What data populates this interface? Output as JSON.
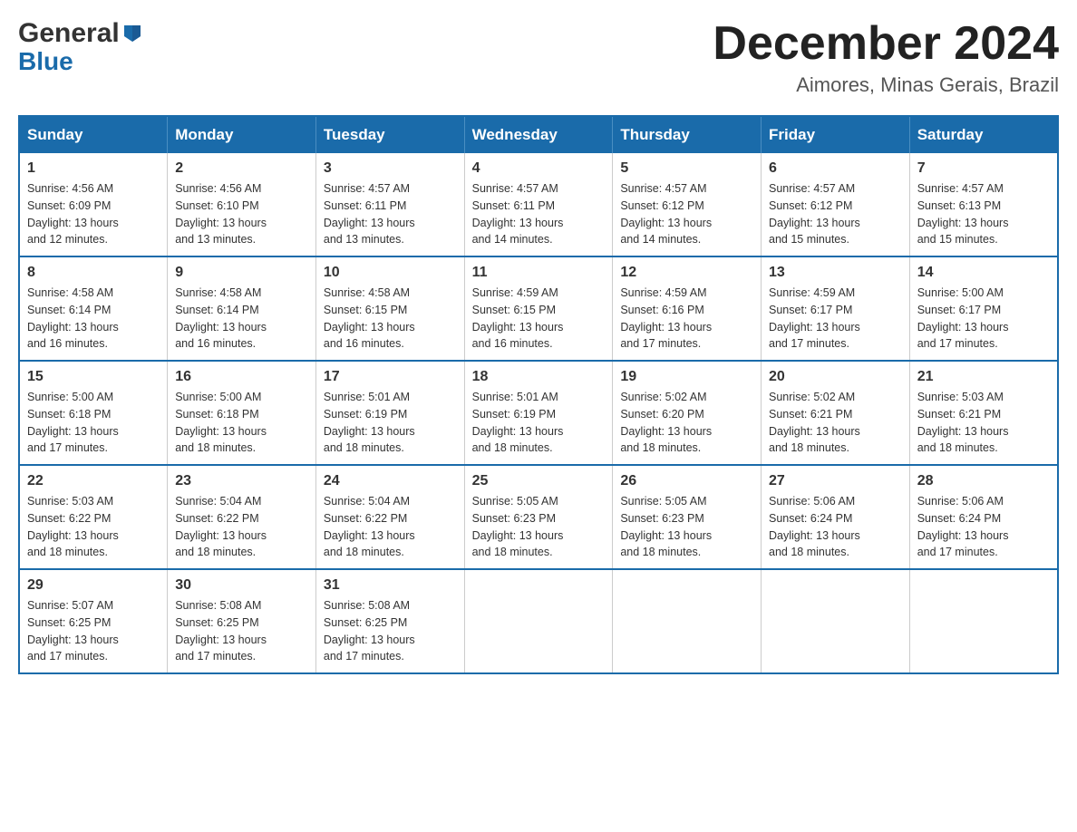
{
  "header": {
    "logo": {
      "general": "General",
      "blue": "Blue",
      "arrow_color": "#1a6baa"
    },
    "title": "December 2024",
    "location": "Aimores, Minas Gerais, Brazil"
  },
  "calendar": {
    "headers": [
      "Sunday",
      "Monday",
      "Tuesday",
      "Wednesday",
      "Thursday",
      "Friday",
      "Saturday"
    ],
    "weeks": [
      [
        {
          "day": "1",
          "sunrise": "4:56 AM",
          "sunset": "6:09 PM",
          "daylight": "13 hours and 12 minutes."
        },
        {
          "day": "2",
          "sunrise": "4:56 AM",
          "sunset": "6:10 PM",
          "daylight": "13 hours and 13 minutes."
        },
        {
          "day": "3",
          "sunrise": "4:57 AM",
          "sunset": "6:11 PM",
          "daylight": "13 hours and 13 minutes."
        },
        {
          "day": "4",
          "sunrise": "4:57 AM",
          "sunset": "6:11 PM",
          "daylight": "13 hours and 14 minutes."
        },
        {
          "day": "5",
          "sunrise": "4:57 AM",
          "sunset": "6:12 PM",
          "daylight": "13 hours and 14 minutes."
        },
        {
          "day": "6",
          "sunrise": "4:57 AM",
          "sunset": "6:12 PM",
          "daylight": "13 hours and 15 minutes."
        },
        {
          "day": "7",
          "sunrise": "4:57 AM",
          "sunset": "6:13 PM",
          "daylight": "13 hours and 15 minutes."
        }
      ],
      [
        {
          "day": "8",
          "sunrise": "4:58 AM",
          "sunset": "6:14 PM",
          "daylight": "13 hours and 16 minutes."
        },
        {
          "day": "9",
          "sunrise": "4:58 AM",
          "sunset": "6:14 PM",
          "daylight": "13 hours and 16 minutes."
        },
        {
          "day": "10",
          "sunrise": "4:58 AM",
          "sunset": "6:15 PM",
          "daylight": "13 hours and 16 minutes."
        },
        {
          "day": "11",
          "sunrise": "4:59 AM",
          "sunset": "6:15 PM",
          "daylight": "13 hours and 16 minutes."
        },
        {
          "day": "12",
          "sunrise": "4:59 AM",
          "sunset": "6:16 PM",
          "daylight": "13 hours and 17 minutes."
        },
        {
          "day": "13",
          "sunrise": "4:59 AM",
          "sunset": "6:17 PM",
          "daylight": "13 hours and 17 minutes."
        },
        {
          "day": "14",
          "sunrise": "5:00 AM",
          "sunset": "6:17 PM",
          "daylight": "13 hours and 17 minutes."
        }
      ],
      [
        {
          "day": "15",
          "sunrise": "5:00 AM",
          "sunset": "6:18 PM",
          "daylight": "13 hours and 17 minutes."
        },
        {
          "day": "16",
          "sunrise": "5:00 AM",
          "sunset": "6:18 PM",
          "daylight": "13 hours and 18 minutes."
        },
        {
          "day": "17",
          "sunrise": "5:01 AM",
          "sunset": "6:19 PM",
          "daylight": "13 hours and 18 minutes."
        },
        {
          "day": "18",
          "sunrise": "5:01 AM",
          "sunset": "6:19 PM",
          "daylight": "13 hours and 18 minutes."
        },
        {
          "day": "19",
          "sunrise": "5:02 AM",
          "sunset": "6:20 PM",
          "daylight": "13 hours and 18 minutes."
        },
        {
          "day": "20",
          "sunrise": "5:02 AM",
          "sunset": "6:21 PM",
          "daylight": "13 hours and 18 minutes."
        },
        {
          "day": "21",
          "sunrise": "5:03 AM",
          "sunset": "6:21 PM",
          "daylight": "13 hours and 18 minutes."
        }
      ],
      [
        {
          "day": "22",
          "sunrise": "5:03 AM",
          "sunset": "6:22 PM",
          "daylight": "13 hours and 18 minutes."
        },
        {
          "day": "23",
          "sunrise": "5:04 AM",
          "sunset": "6:22 PM",
          "daylight": "13 hours and 18 minutes."
        },
        {
          "day": "24",
          "sunrise": "5:04 AM",
          "sunset": "6:22 PM",
          "daylight": "13 hours and 18 minutes."
        },
        {
          "day": "25",
          "sunrise": "5:05 AM",
          "sunset": "6:23 PM",
          "daylight": "13 hours and 18 minutes."
        },
        {
          "day": "26",
          "sunrise": "5:05 AM",
          "sunset": "6:23 PM",
          "daylight": "13 hours and 18 minutes."
        },
        {
          "day": "27",
          "sunrise": "5:06 AM",
          "sunset": "6:24 PM",
          "daylight": "13 hours and 18 minutes."
        },
        {
          "day": "28",
          "sunrise": "5:06 AM",
          "sunset": "6:24 PM",
          "daylight": "13 hours and 17 minutes."
        }
      ],
      [
        {
          "day": "29",
          "sunrise": "5:07 AM",
          "sunset": "6:25 PM",
          "daylight": "13 hours and 17 minutes."
        },
        {
          "day": "30",
          "sunrise": "5:08 AM",
          "sunset": "6:25 PM",
          "daylight": "13 hours and 17 minutes."
        },
        {
          "day": "31",
          "sunrise": "5:08 AM",
          "sunset": "6:25 PM",
          "daylight": "13 hours and 17 minutes."
        },
        null,
        null,
        null,
        null
      ]
    ],
    "labels": {
      "sunrise": "Sunrise:",
      "sunset": "Sunset:",
      "daylight": "Daylight:"
    }
  }
}
